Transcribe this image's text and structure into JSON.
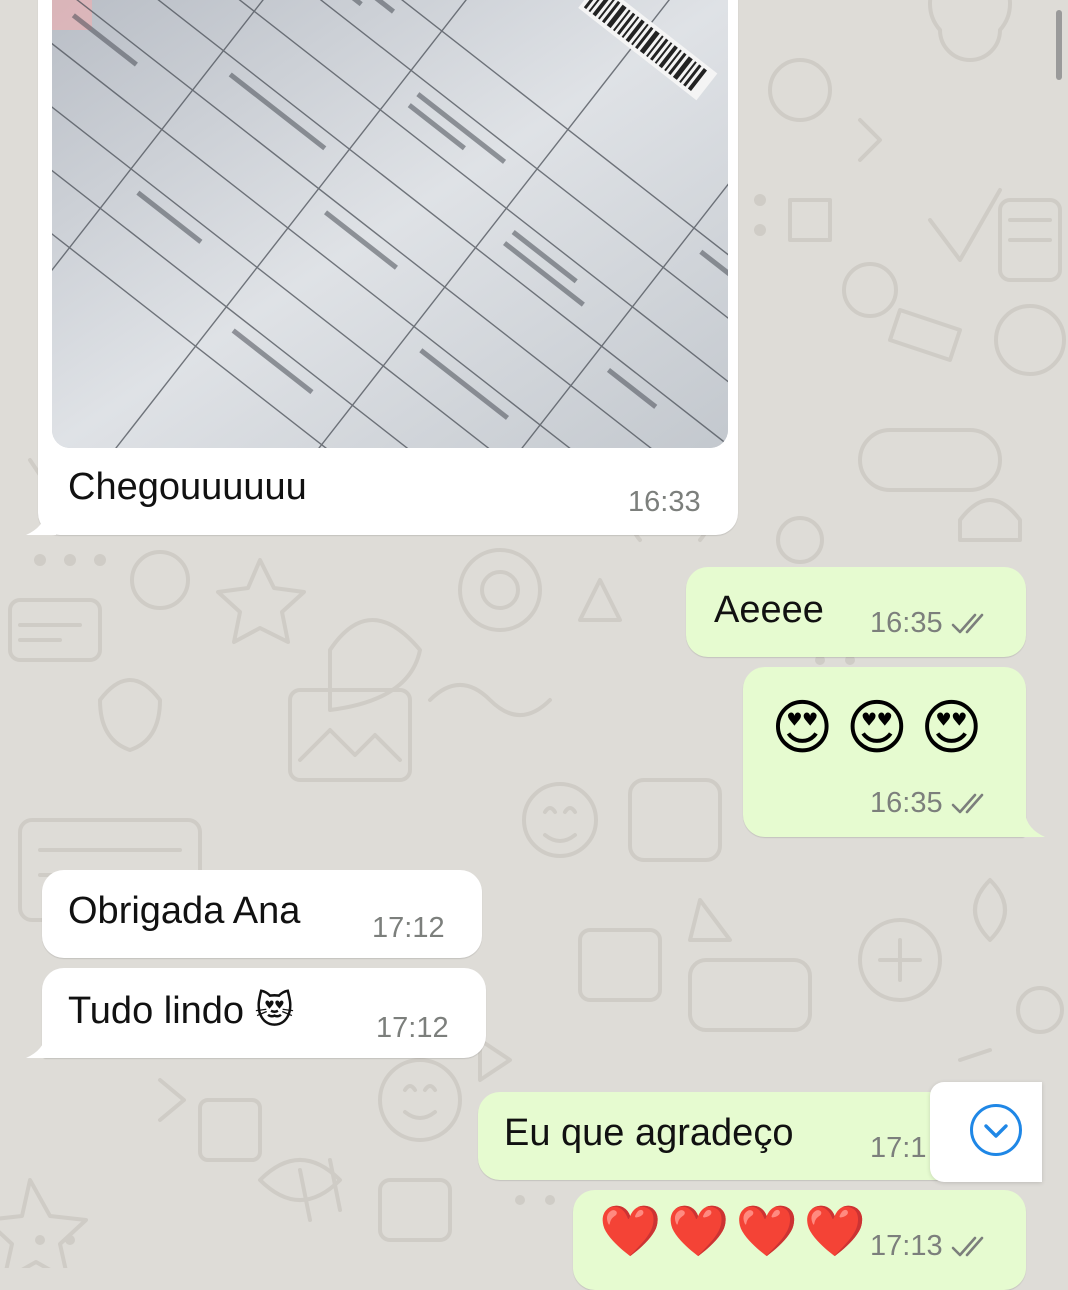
{
  "colors": {
    "incoming_bubble": "#ffffff",
    "outgoing_bubble": "#e6fbd0",
    "wallpaper": "#dedcd7",
    "read_ticks": "#7c7f7c",
    "scroll_button_accent": "#1f87e6"
  },
  "messages": [
    {
      "id": "m1",
      "direction": "incoming",
      "type": "image",
      "caption": "Chegouuuuuu",
      "time": "16:33"
    },
    {
      "id": "m2",
      "direction": "outgoing",
      "text": "Aeeee",
      "time": "16:35",
      "status": "read"
    },
    {
      "id": "m3",
      "direction": "outgoing",
      "type": "emoji",
      "emoji": [
        "😍",
        "😍",
        "😍"
      ],
      "time": "16:35",
      "status": "read"
    },
    {
      "id": "m4",
      "direction": "incoming",
      "text": "Obrigada Ana",
      "time": "17:12"
    },
    {
      "id": "m5",
      "direction": "incoming",
      "text": "Tudo lindo 😻",
      "time": "17:12"
    },
    {
      "id": "m6",
      "direction": "outgoing",
      "text": "Eu que agradeço",
      "time": "17:1",
      "status": "read"
    },
    {
      "id": "m7",
      "direction": "outgoing",
      "type": "emoji",
      "emoji": [
        "❤️",
        "❤️",
        "❤️",
        "❤️"
      ],
      "time": "17:13",
      "status": "read"
    }
  ],
  "scroll_down_button": {
    "icon": "chevron-down-icon"
  }
}
